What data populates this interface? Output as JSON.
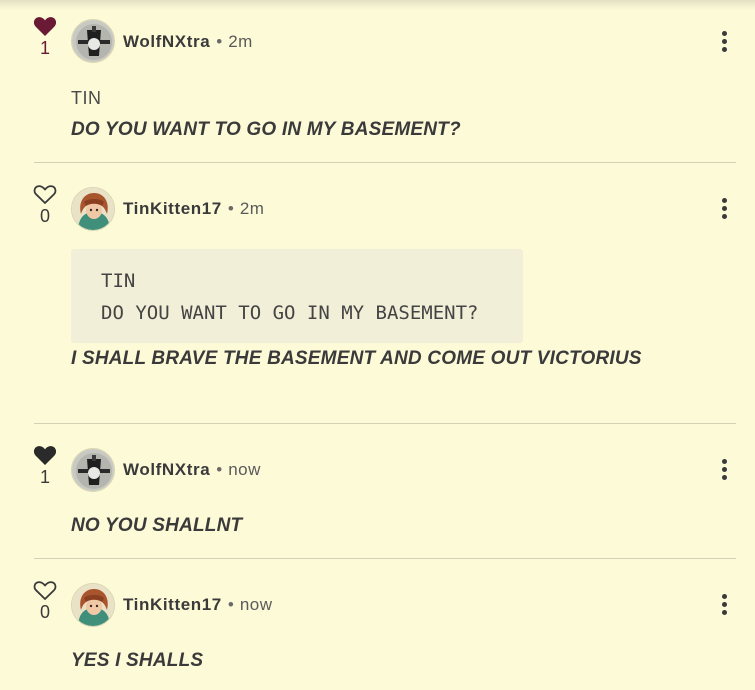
{
  "colors": {
    "background": "#fdfad8",
    "liked_heart": "#6b1a35",
    "text": "#3a3a3a"
  },
  "comments": [
    {
      "liked": true,
      "like_count": "1",
      "username": "WolfNXtra",
      "separator": "•",
      "time": "2m",
      "avatar_icon": "avatar-wolfnxtra",
      "plain_line": "TIN",
      "body": "DO YOU WANT TO GO IN MY BASEMENT?"
    },
    {
      "liked": false,
      "like_count": "0",
      "username": "TinKitten17",
      "separator": "•",
      "time": "2m",
      "avatar_icon": "avatar-tinkitten17",
      "quote_lines": [
        "TIN",
        "DO YOU WANT TO GO IN MY BASEMENT?"
      ],
      "body": "I SHALL BRAVE THE BASEMENT AND COME OUT VICTORIUS"
    },
    {
      "liked": true,
      "like_count": "1",
      "username": "WolfNXtra",
      "separator": "•",
      "time": "now",
      "avatar_icon": "avatar-wolfnxtra",
      "body": "NO YOU SHALLNT"
    },
    {
      "liked": false,
      "like_count": "0",
      "username": "TinKitten17",
      "separator": "•",
      "time": "now",
      "avatar_icon": "avatar-tinkitten17",
      "body": "YES I SHALLS"
    }
  ]
}
